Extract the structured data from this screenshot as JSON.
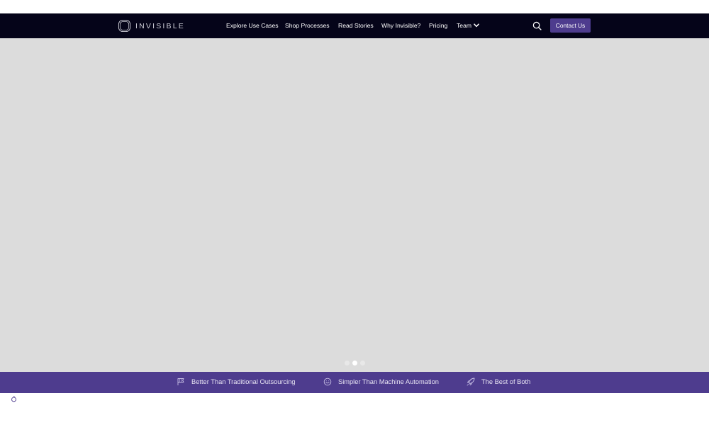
{
  "header": {
    "logo_text": "INVISIBLE",
    "nav": [
      {
        "label": "Explore Use Cases"
      },
      {
        "label": "Shop Processes"
      },
      {
        "label": "Read Stories"
      },
      {
        "label": "Why Invisible?"
      },
      {
        "label": "Pricing"
      },
      {
        "label": "Team"
      }
    ],
    "search_icon": "search-icon",
    "contact_label": "Contact Us"
  },
  "hero": {
    "slides_count": 3,
    "active_slide": 2
  },
  "features": [
    {
      "icon": "flag-icon",
      "label": "Better Than Traditional Outsourcing"
    },
    {
      "icon": "smiley-icon",
      "label": "Simpler Than Machine Automation"
    },
    {
      "icon": "rocket-icon",
      "label": "The Best of Both"
    }
  ],
  "colors": {
    "nav_bg": "#050419",
    "accent": "#4e3c8e",
    "hero_bg": "#dcdcdc"
  }
}
